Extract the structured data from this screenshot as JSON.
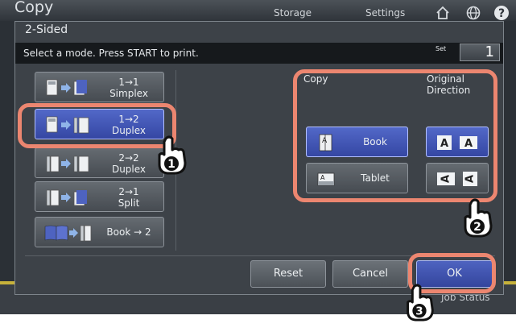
{
  "app": {
    "title": "Copy",
    "tabs": [
      "Storage",
      "Settings"
    ],
    "job_status": "Job Status"
  },
  "dialog": {
    "title": "2-Sided",
    "message": "Select a mode. Press START to print.",
    "set_label": "Set",
    "set_value": "1"
  },
  "modes": [
    {
      "label": "1→1\nSimplex",
      "selected": false
    },
    {
      "label": "1→2\nDuplex",
      "selected": true
    },
    {
      "label": "2→2\nDuplex",
      "selected": false
    },
    {
      "label": "2→1\nSplit",
      "selected": false
    },
    {
      "label": "Book → 2",
      "selected": false
    }
  ],
  "copy_section": {
    "label": "Copy",
    "options": [
      {
        "label": "Book",
        "selected": true
      },
      {
        "label": "Tablet",
        "selected": false
      }
    ]
  },
  "direction_section": {
    "label": "Original\nDirection",
    "glyph": "A",
    "options": [
      {
        "name": "upright",
        "selected": true
      },
      {
        "name": "rotated",
        "selected": false
      }
    ]
  },
  "footer": {
    "reset": "Reset",
    "cancel": "Cancel",
    "ok": "OK"
  },
  "callouts": [
    "1",
    "2",
    "3"
  ],
  "colors": {
    "selected": "#3d52b4",
    "callout": "#ec8670",
    "background": "#3d4248"
  }
}
